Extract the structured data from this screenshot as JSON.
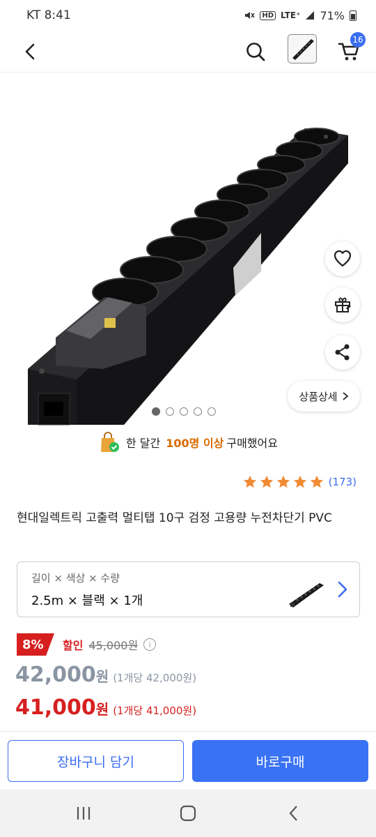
{
  "status_bar": {
    "carrier_time": "KT 8:41",
    "network": "LTE⁺",
    "hd": "HD",
    "battery": "71%"
  },
  "top_bar": {
    "cart_count": "16",
    "icons": [
      "back-arrow-icon",
      "search-icon",
      "product-thumbnail",
      "cart-icon"
    ]
  },
  "gallery": {
    "detail_button": "상품상세",
    "current_image": 1,
    "total_images": 5
  },
  "purchase_note": {
    "prefix": "한 달간",
    "highlight": "100명 이상",
    "suffix": "구매했어요"
  },
  "rating": {
    "stars": 5,
    "count": "(173)"
  },
  "product": {
    "title": "현대일렉트릭 고출력 멀티탭 10구 검정 고용량 누전차단기 PVC"
  },
  "option": {
    "label": "길이 × 색상 × 수량",
    "value": "2.5m × 블랙 × 1개"
  },
  "pricing": {
    "discount_rate": "8%",
    "discount_label": "할인",
    "original_price": "45,000원",
    "sale_price": "42,000",
    "sale_won": "원",
    "sale_unit": "(1개당 42,000원)",
    "final_price": "41,000",
    "final_won": "원",
    "final_unit": "(1개당 41,000원)"
  },
  "actions": {
    "cart_button": "장바구니 담기",
    "buy_button": "바로구매"
  },
  "colors": {
    "accent_blue": "#3a6df0",
    "discount_red": "#d71f1f",
    "highlight_orange": "#d96a00",
    "star_orange": "#f08a33"
  }
}
